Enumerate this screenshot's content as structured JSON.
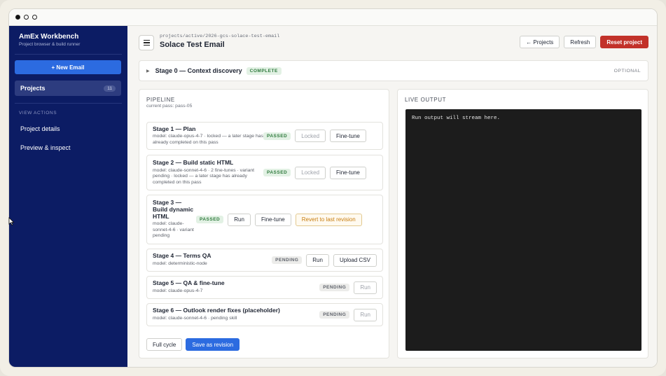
{
  "window": {
    "controls": [
      "close",
      "minimize",
      "zoom"
    ]
  },
  "sidebar": {
    "title": "AmEx Workbench",
    "subtitle": "Project browser & build runner",
    "new_button": "+ New Email",
    "projects_label": "Projects",
    "projects_count": "11",
    "section_label": "VIEW ACTIONS",
    "items": [
      {
        "label": "Project details"
      },
      {
        "label": "Preview & inspect"
      }
    ]
  },
  "header": {
    "path": "projects/active/2026-gcs-solace-test-email",
    "title": "Solace Test Email",
    "buttons": {
      "projects": "← Projects",
      "refresh": "Refresh",
      "reset": "Reset project"
    }
  },
  "stage0": {
    "title": "Stage 0 — Context discovery",
    "status": "COMPLETE",
    "optional": "OPTIONAL"
  },
  "pipeline": {
    "title": "PIPELINE",
    "subtitle": "current pass: pass-05",
    "stages": [
      {
        "name": "Stage 1 — Plan",
        "desc": "model: claude-opus-4-7 · locked — a later stage has already completed on this pass",
        "status": "PASSED",
        "actions": [
          "Locked",
          "Fine-tune"
        ]
      },
      {
        "name": "Stage 2 — Build static HTML",
        "desc": "model: claude-sonnet-4-6 · 2 fine-tunes · variant pending · locked — a later stage has already completed on this pass",
        "status": "PASSED",
        "actions": [
          "Locked",
          "Fine-tune"
        ]
      },
      {
        "name": "Stage 3 — Build dynamic HTML",
        "desc": "model: claude-sonnet-4-6 · variant pending",
        "status": "PASSED",
        "actions": [
          "Run",
          "Fine-tune",
          "Revert to last revision"
        ]
      },
      {
        "name": "Stage 4 — Terms QA",
        "desc": "model: deterministic-node",
        "status": "PENDING",
        "actions": [
          "Run",
          "Upload CSV"
        ]
      },
      {
        "name": "Stage 5 — QA & fine-tune",
        "desc": "model: claude-opus-4-7",
        "status": "PENDING",
        "actions": [
          "Run"
        ]
      },
      {
        "name": "Stage 6 — Outlook render fixes (placeholder)",
        "desc": "model: claude-sonnet-4-6 · pending skill",
        "status": "PENDING",
        "actions": [
          "Run"
        ]
      }
    ],
    "full_cycle": "Full cycle",
    "save_revision": "Save as revision"
  },
  "live_output": {
    "title": "LIVE OUTPUT",
    "placeholder": "Run output will stream here."
  },
  "colors": {
    "sidebar": "#0c1c64",
    "accent": "#2c6be0",
    "danger": "#c2322a",
    "passed": "#2f7a3d"
  }
}
